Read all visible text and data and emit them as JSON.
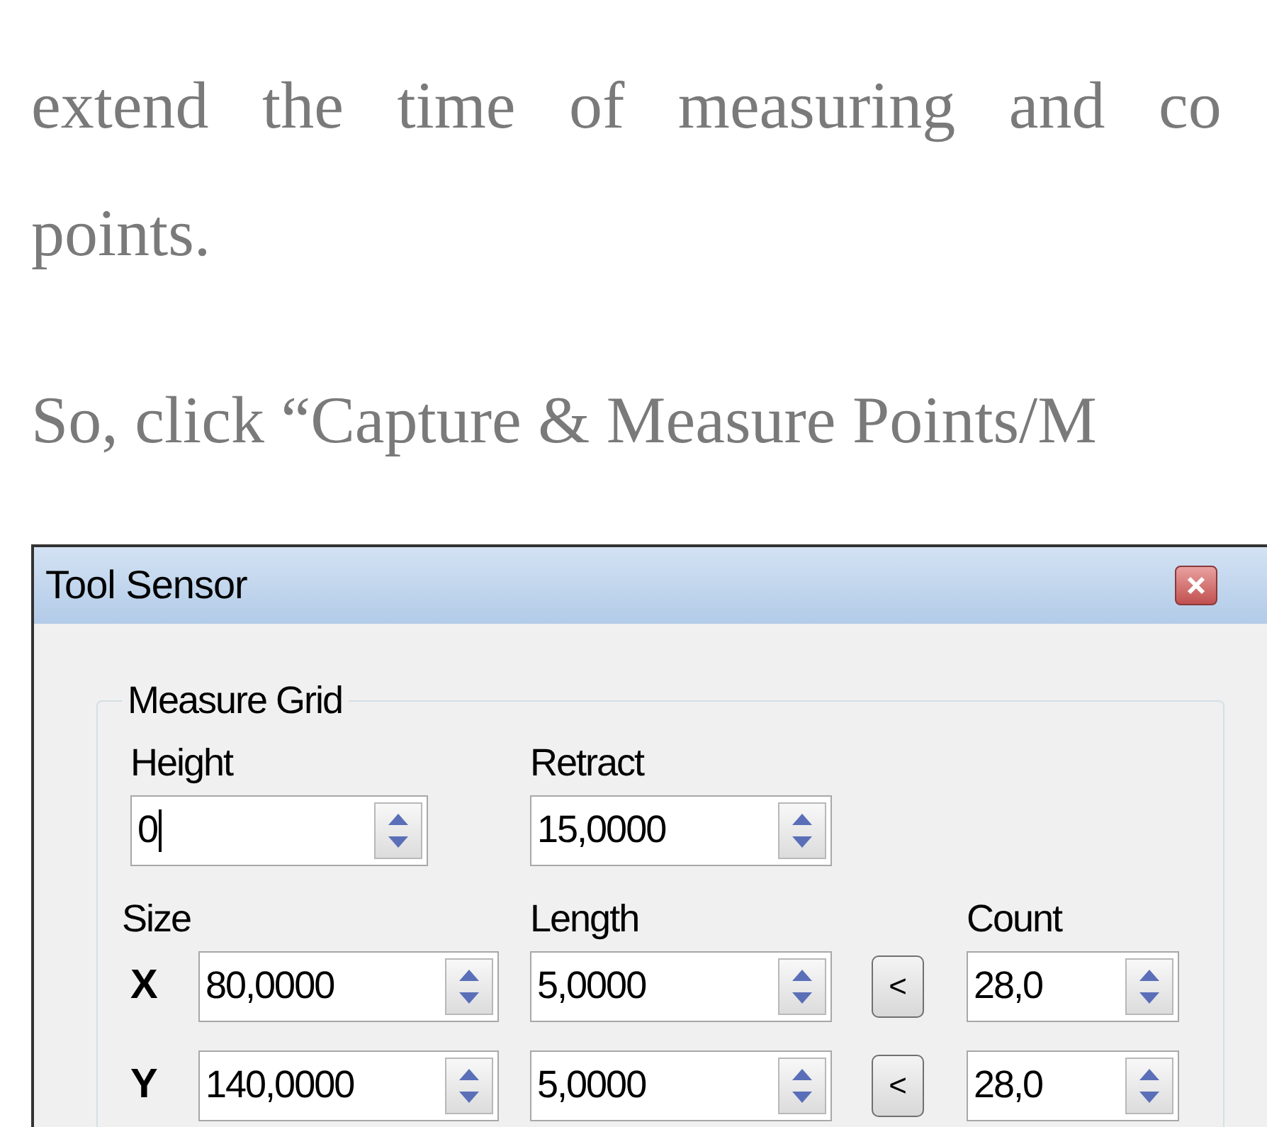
{
  "paragraph_lines": [
    "extend the time of measuring and co",
    "points."
  ],
  "instruction": "So, click “Capture & Measure Points/M",
  "dialog": {
    "title": "Tool Sensor",
    "group": {
      "label": "Measure Grid",
      "height": {
        "label": "Height",
        "value": "0",
        "focused": true
      },
      "retract": {
        "label": "Retract",
        "value": "15,0000",
        "focused": false
      },
      "size_label": "Size",
      "length_label": "Length",
      "count_label": "Count",
      "rows": [
        {
          "axis": "X",
          "size": "80,0000",
          "length": "5,0000",
          "copy_button": "<",
          "count": "28,0"
        },
        {
          "axis": "Y",
          "size": "140,0000",
          "length": "5,0000",
          "copy_button": "<",
          "count": "28,0"
        }
      ]
    }
  }
}
